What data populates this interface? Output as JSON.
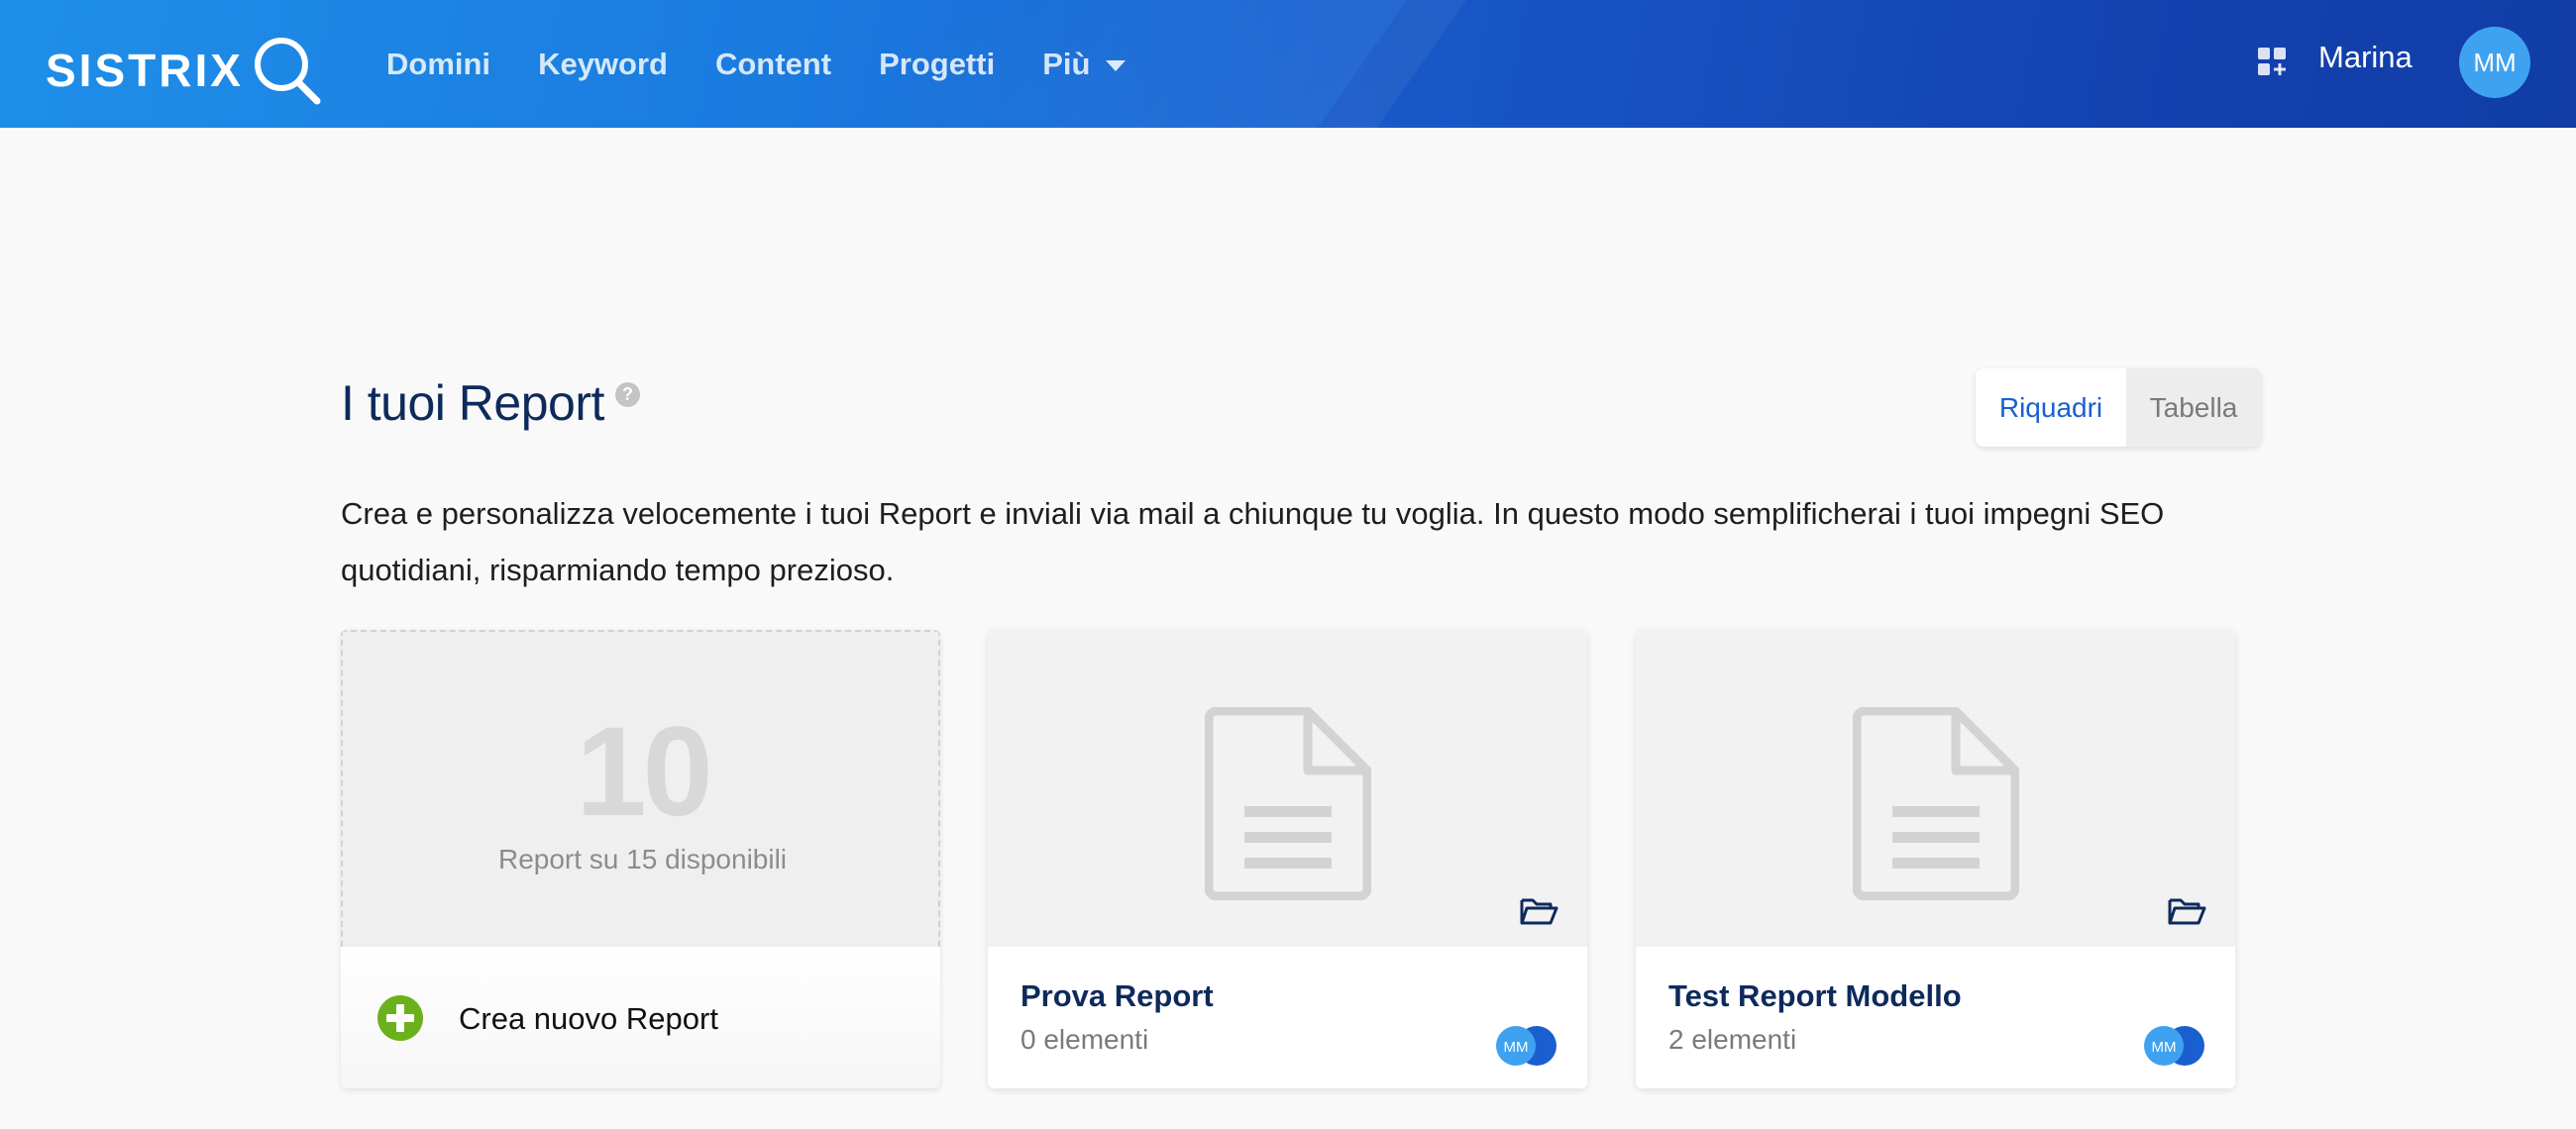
{
  "header": {
    "brand": "SISTRIX",
    "nav": [
      {
        "label": "Domini"
      },
      {
        "label": "Keyword"
      },
      {
        "label": "Content"
      },
      {
        "label": "Progetti"
      },
      {
        "label": "Più"
      }
    ],
    "user_name": "Marina",
    "avatar_initials": "MM",
    "icons": {
      "apps": "apps-grid-icon",
      "search": "magnifier-icon"
    }
  },
  "main": {
    "title": "I tuoi Report",
    "help_icon_glyph": "?",
    "view_toggle": {
      "active": "Riquadri",
      "inactive": "Tabella"
    },
    "description": "Crea e personalizza velocemente i tuoi Report e inviali via mail a chiunque tu voglia. In questo modo semplificherai i tuoi impegni SEO quotidiani, risparmiando tempo prezioso."
  },
  "new_card": {
    "quota_number": "10",
    "quota_label": "Report su 15 disponibili",
    "action_label": "Crea nuovo Report"
  },
  "reports": [
    {
      "title": "Prova Report",
      "items": "0 elementi",
      "owner_initials": "MM"
    },
    {
      "title": "Test Report Modello",
      "items": "2 elementi",
      "owner_initials": "MM"
    }
  ],
  "colors": {
    "header_start": "#1f8fe8",
    "header_end": "#123fa8",
    "title_navy": "#0e2a5c",
    "accent_blue": "#1a5fcf",
    "plus_green": "#6bb11b",
    "avatar_blue": "#3fa2f0"
  }
}
